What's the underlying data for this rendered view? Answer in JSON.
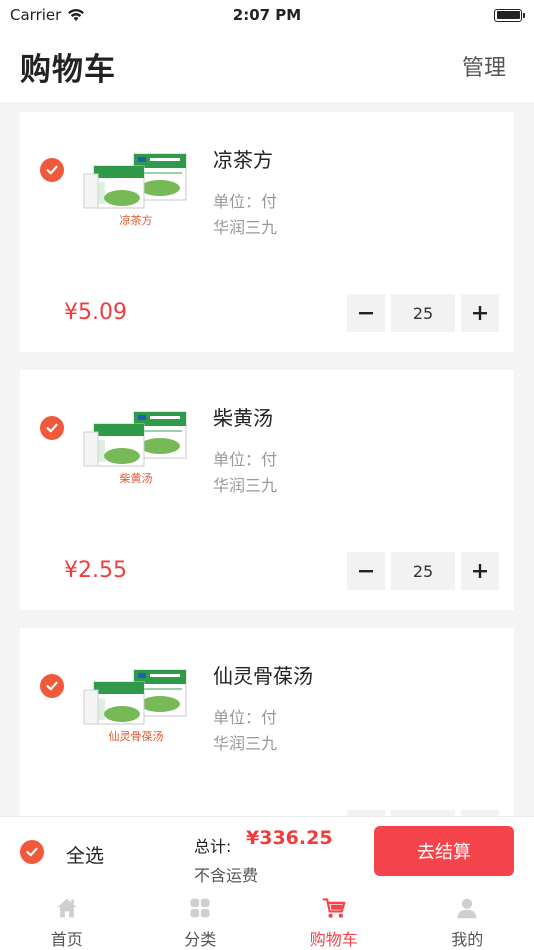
{
  "status_bar": {
    "carrier": "Carrier",
    "time": "2:07 PM"
  },
  "nav": {
    "title": "购物车",
    "manage": "管理"
  },
  "cart": {
    "items": [
      {
        "caption": "凉茶方",
        "name": "凉茶方",
        "unit": "单位：付",
        "maker": "华润三九",
        "price": "¥5.09",
        "quantity": "25"
      },
      {
        "caption": "柴黄汤",
        "name": "柴黄汤",
        "unit": "单位：付",
        "maker": "华润三九",
        "price": "¥2.55",
        "quantity": "25"
      },
      {
        "caption": "仙灵骨葆汤",
        "name": "仙灵骨葆汤",
        "unit": "单位：付",
        "maker": "华润三九",
        "price": "",
        "quantity": ""
      }
    ]
  },
  "checkout": {
    "select_all": "全选",
    "total_label": "总计:",
    "total_value": "¥336.25",
    "shipping_note": "不含运费",
    "checkout_button": "去结算"
  },
  "tabs": [
    {
      "label": "首页",
      "icon": "home-icon"
    },
    {
      "label": "分类",
      "icon": "category-grid-icon"
    },
    {
      "label": "购物车",
      "icon": "cart-icon",
      "active": true
    },
    {
      "label": "我的",
      "icon": "user-icon"
    }
  ],
  "colors": {
    "accent": "#f5434b",
    "check": "#f05a3b",
    "price": "#f03c3c",
    "inactive_icon": "#cfcfcf"
  }
}
